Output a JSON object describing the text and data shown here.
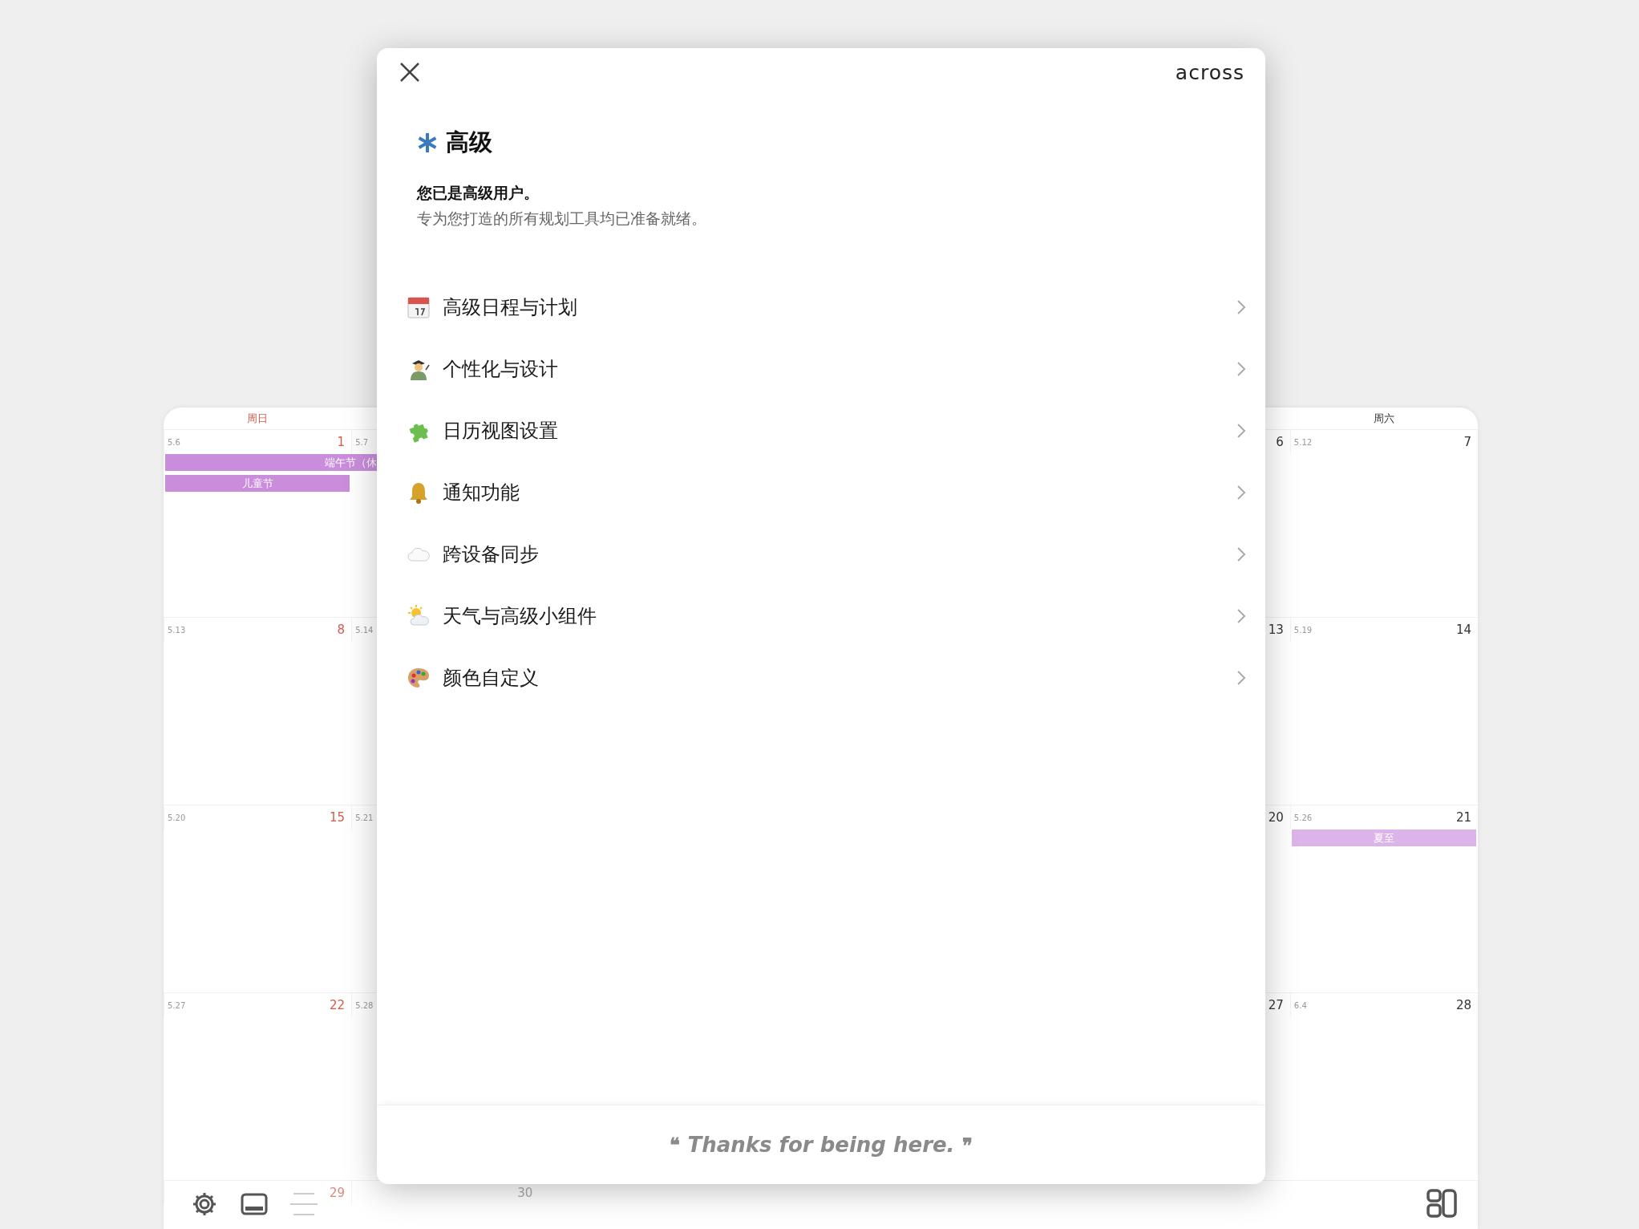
{
  "calendar": {
    "sunday_header": "周日",
    "saturday_header": "周六",
    "weeks": [
      {
        "sunday": {
          "lunar": "5.6",
          "day": "1"
        },
        "monday": {
          "lunar": "5.7"
        },
        "friday": {
          "day": "6"
        },
        "saturday": {
          "lunar": "5.12",
          "day": "7"
        },
        "sunday_events": [
          {
            "label": "端午节（休",
            "kind": "continued",
            "color": "#c98ddb"
          },
          {
            "label": "儿童节",
            "kind": "single",
            "color": "#c98ddb"
          }
        ]
      },
      {
        "sunday": {
          "lunar": "5.13",
          "day": "8"
        },
        "monday": {
          "lunar": "5.14"
        },
        "friday": {
          "day": "13"
        },
        "saturday": {
          "lunar": "5.19",
          "day": "14"
        }
      },
      {
        "sunday": {
          "lunar": "5.20",
          "day": "15"
        },
        "monday": {
          "lunar": "5.21"
        },
        "friday": {
          "day": "20"
        },
        "saturday": {
          "lunar": "5.26",
          "day": "21"
        },
        "saturday_events": [
          {
            "label": "夏至",
            "kind": "single",
            "color": "#dcb4ea"
          }
        ]
      },
      {
        "sunday": {
          "lunar": "5.27",
          "day": "22"
        },
        "monday": {
          "lunar": "5.28"
        },
        "friday": {
          "day": "27"
        },
        "saturday": {
          "lunar": "6.4",
          "day": "28"
        }
      },
      {
        "sunday": {
          "day": "29"
        },
        "monday": {
          "day": "30"
        }
      }
    ]
  },
  "modal": {
    "logo": "across",
    "title": "高级",
    "lead": "您已是高级用户。",
    "subtitle": "专为您打造的所有规划工具均已准备就绪。",
    "features": [
      {
        "label": "高级日程与计划"
      },
      {
        "label": "个性化与设计"
      },
      {
        "label": "日历视图设置"
      },
      {
        "label": "通知功能"
      },
      {
        "label": "跨设备同步"
      },
      {
        "label": "天气与高级小组件"
      },
      {
        "label": "颜色自定义"
      }
    ],
    "footer": {
      "open_quote": "❝",
      "text": "Thanks for being here.",
      "close_quote": "❞"
    }
  }
}
